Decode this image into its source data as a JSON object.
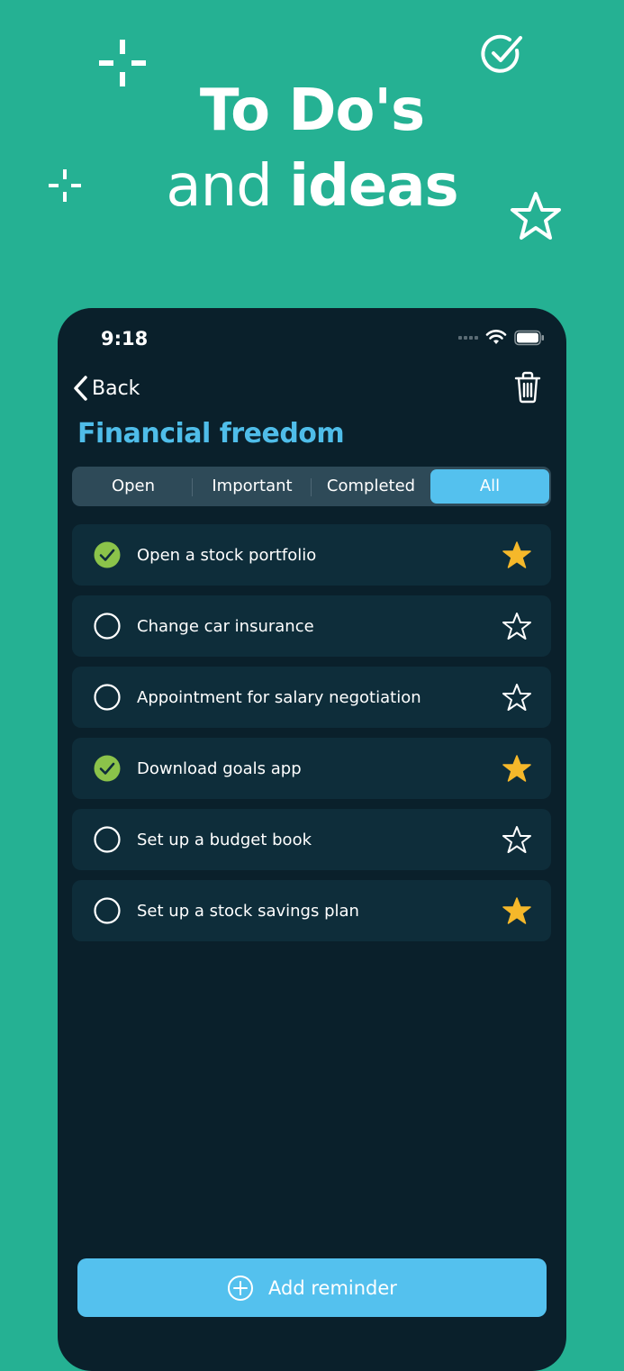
{
  "promo": {
    "line1": "To Do's",
    "line2_regular": "and ",
    "line2_bold": "ideas",
    "decorations": [
      "sparkle-icon",
      "sparkle-icon",
      "check-circle-icon",
      "star-outline-icon"
    ]
  },
  "status_bar": {
    "time": "9:18",
    "icons": [
      "signal-icon",
      "wifi-icon",
      "battery-icon"
    ]
  },
  "nav": {
    "back_label": "Back",
    "trash_icon": "trash-icon"
  },
  "page": {
    "title": "Financial freedom"
  },
  "filters": {
    "tabs": [
      {
        "label": "Open",
        "active": false
      },
      {
        "label": "Important",
        "active": false
      },
      {
        "label": "Completed",
        "active": false
      },
      {
        "label": "All",
        "active": true
      }
    ]
  },
  "reminders": [
    {
      "label": "Open a stock portfolio",
      "completed": true,
      "starred": true
    },
    {
      "label": "Change car insurance",
      "completed": false,
      "starred": false
    },
    {
      "label": "Appointment for salary negotiation",
      "completed": false,
      "starred": false
    },
    {
      "label": "Download goals app",
      "completed": true,
      "starred": true
    },
    {
      "label": "Set up a budget book",
      "completed": false,
      "starred": false
    },
    {
      "label": "Set up a stock savings plan",
      "completed": false,
      "starred": true
    }
  ],
  "add_button": {
    "label": "Add reminder",
    "icon": "plus-circle-icon"
  },
  "colors": {
    "background": "#25b193",
    "phone_bg": "#0a202b",
    "row_bg": "#0e2d3a",
    "accent": "#54c1ee",
    "title": "#4fbde9",
    "check_green": "#8bc34a",
    "star_gold": "#f5b82a"
  }
}
